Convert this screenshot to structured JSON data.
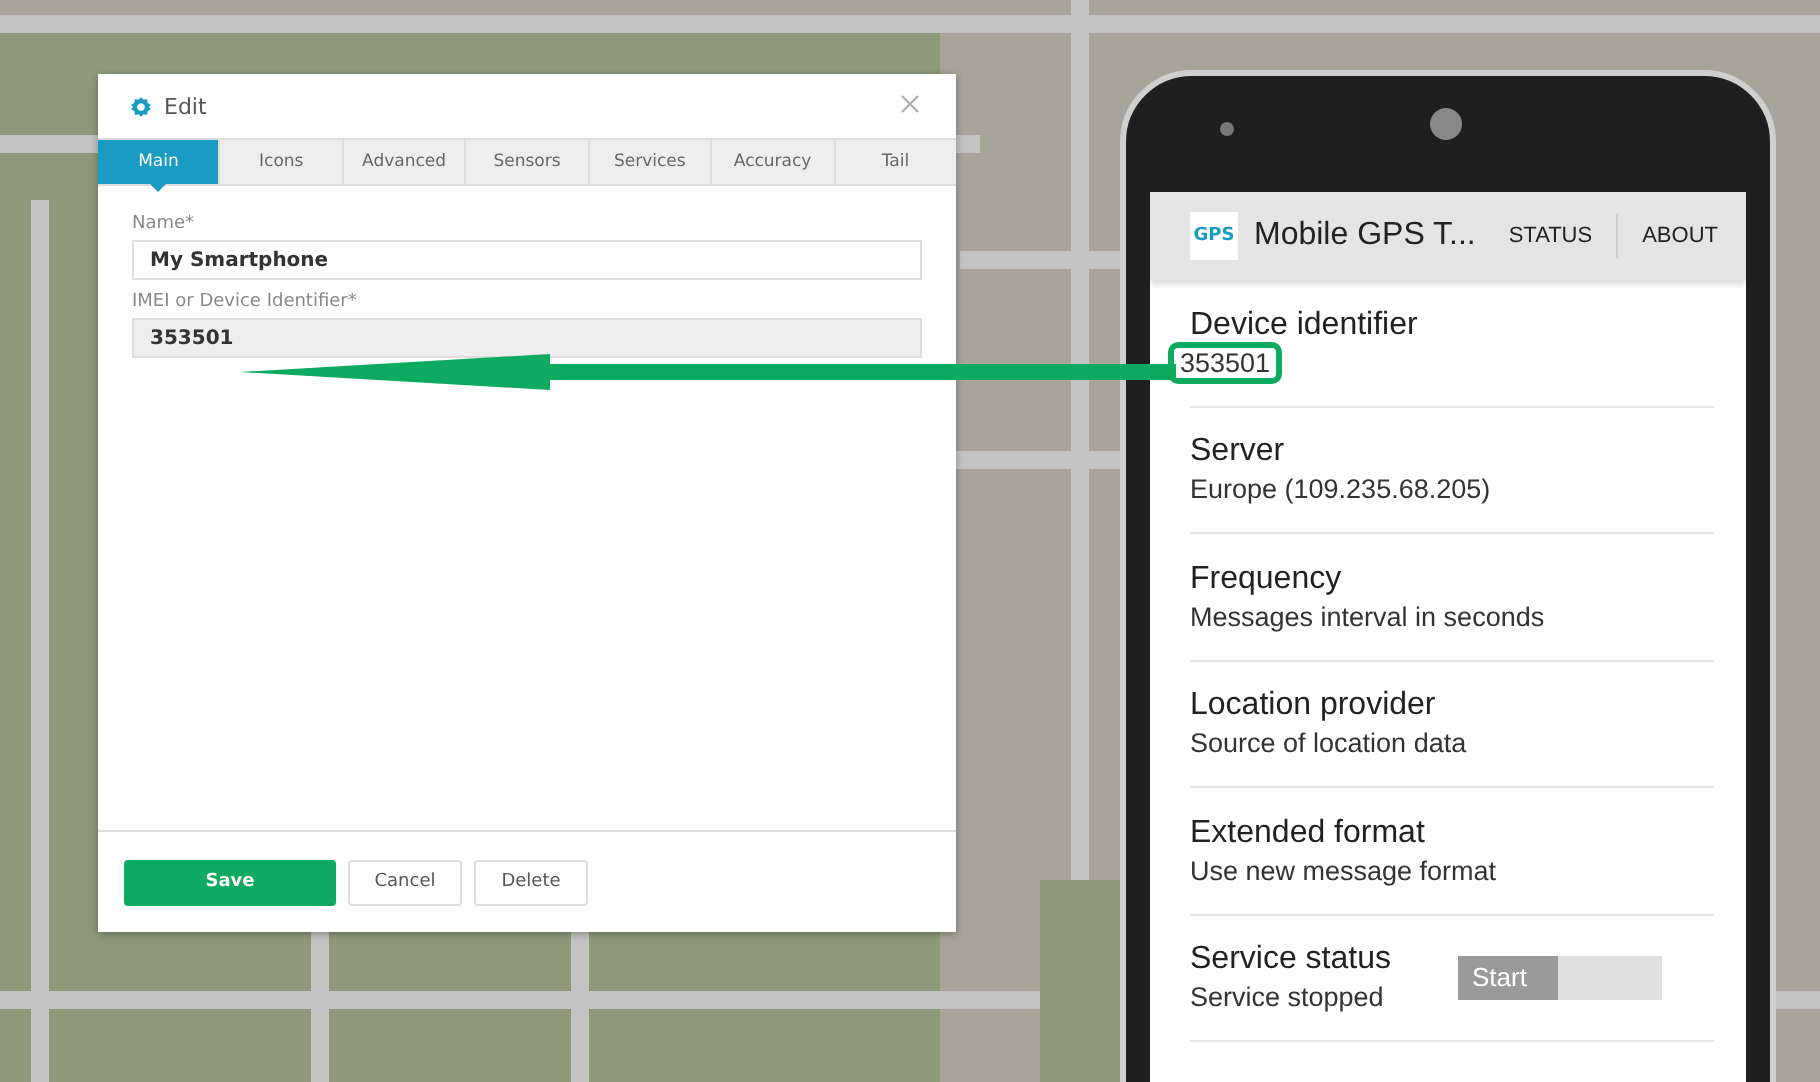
{
  "dialog": {
    "title": "Edit",
    "tabs": [
      {
        "label": "Main",
        "selected": true
      },
      {
        "label": "Icons",
        "selected": false
      },
      {
        "label": "Advanced",
        "selected": false
      },
      {
        "label": "Sensors",
        "selected": false
      },
      {
        "label": "Services",
        "selected": false
      },
      {
        "label": "Accuracy",
        "selected": false
      },
      {
        "label": "Tail",
        "selected": false
      }
    ],
    "fields": [
      {
        "label": "Name*",
        "value": "My Smartphone",
        "disabled": false
      },
      {
        "label": "IMEI or Device Identifier*",
        "value": "353501",
        "disabled": true
      }
    ],
    "buttons": [
      {
        "label": "Save",
        "kind": "primary"
      },
      {
        "label": "Cancel",
        "kind": "secondary"
      },
      {
        "label": "Delete",
        "kind": "secondary"
      }
    ]
  },
  "phone": {
    "app_bar": {
      "logo_text": "GPS",
      "title": "Mobile GPS T...",
      "actions": [
        "STATUS",
        "ABOUT"
      ]
    },
    "settings": [
      {
        "title": "Device identifier",
        "subtitle": "353501",
        "highlighted": true
      },
      {
        "title": "Server",
        "subtitle": "Europe (109.235.68.205)",
        "highlighted": false
      },
      {
        "title": "Frequency",
        "subtitle": "Messages interval in seconds",
        "highlighted": false
      },
      {
        "title": "Location provider",
        "subtitle": "Source of location data",
        "highlighted": false
      },
      {
        "title": "Extended format",
        "subtitle": "Use new message format",
        "highlighted": false
      },
      {
        "title": "Service status",
        "subtitle": "Service stopped",
        "highlighted": false,
        "toggle": {
          "label": "Start",
          "on": false
        }
      }
    ]
  }
}
